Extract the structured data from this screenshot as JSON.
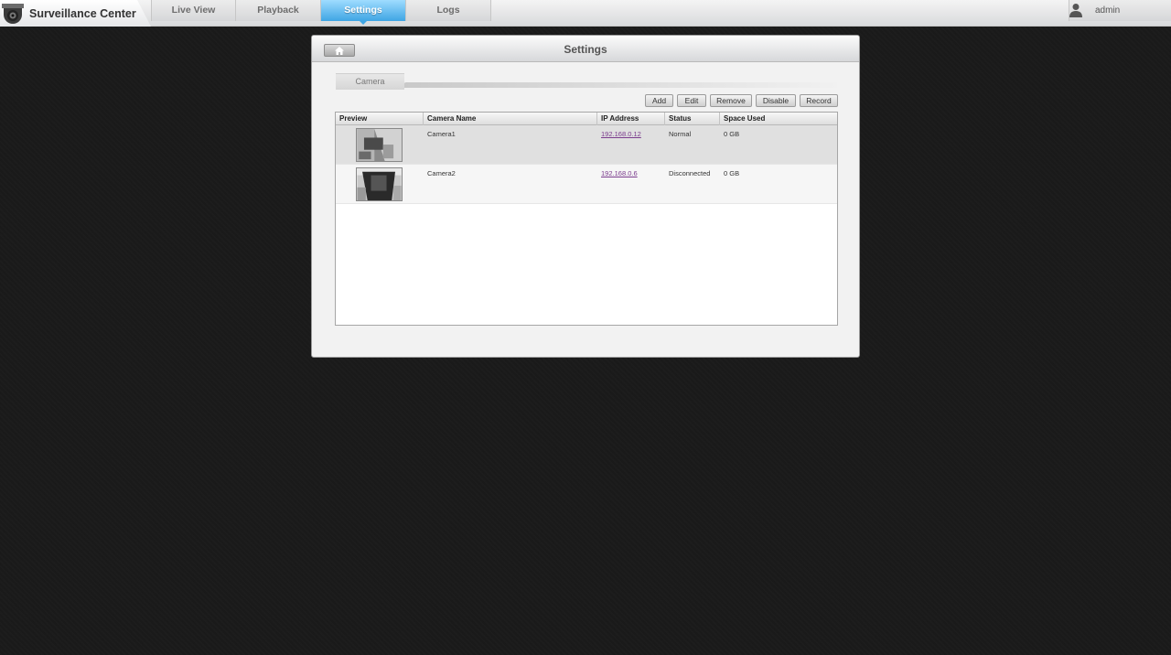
{
  "app": {
    "title": "Surveillance Center",
    "user": "admin"
  },
  "nav": {
    "items": [
      {
        "label": "Live View",
        "active": false
      },
      {
        "label": "Playback",
        "active": false
      },
      {
        "label": "Settings",
        "active": true
      },
      {
        "label": "Logs",
        "active": false
      }
    ]
  },
  "panel": {
    "title": "Settings",
    "tab": "Camera",
    "toolbar": {
      "add": "Add",
      "edit": "Edit",
      "remove": "Remove",
      "disable": "Disable",
      "record": "Record"
    },
    "table": {
      "columns": [
        "Preview",
        "Camera Name",
        "IP Address",
        "Status",
        "Space Used"
      ],
      "rows": [
        {
          "name": "Camera1",
          "ip": "192.168.0.12",
          "status": "Normal",
          "space": "0 GB"
        },
        {
          "name": "Camera2",
          "ip": "192.168.0.6",
          "status": "Disconnected",
          "space": "0 GB"
        }
      ]
    }
  },
  "colors": {
    "accent": "#3fa5e4",
    "background": "#1a1a1a",
    "link": "#7a3a8c"
  },
  "icons": {
    "brand": "camera-dome-icon",
    "user": "user-icon",
    "home": "home-icon"
  }
}
